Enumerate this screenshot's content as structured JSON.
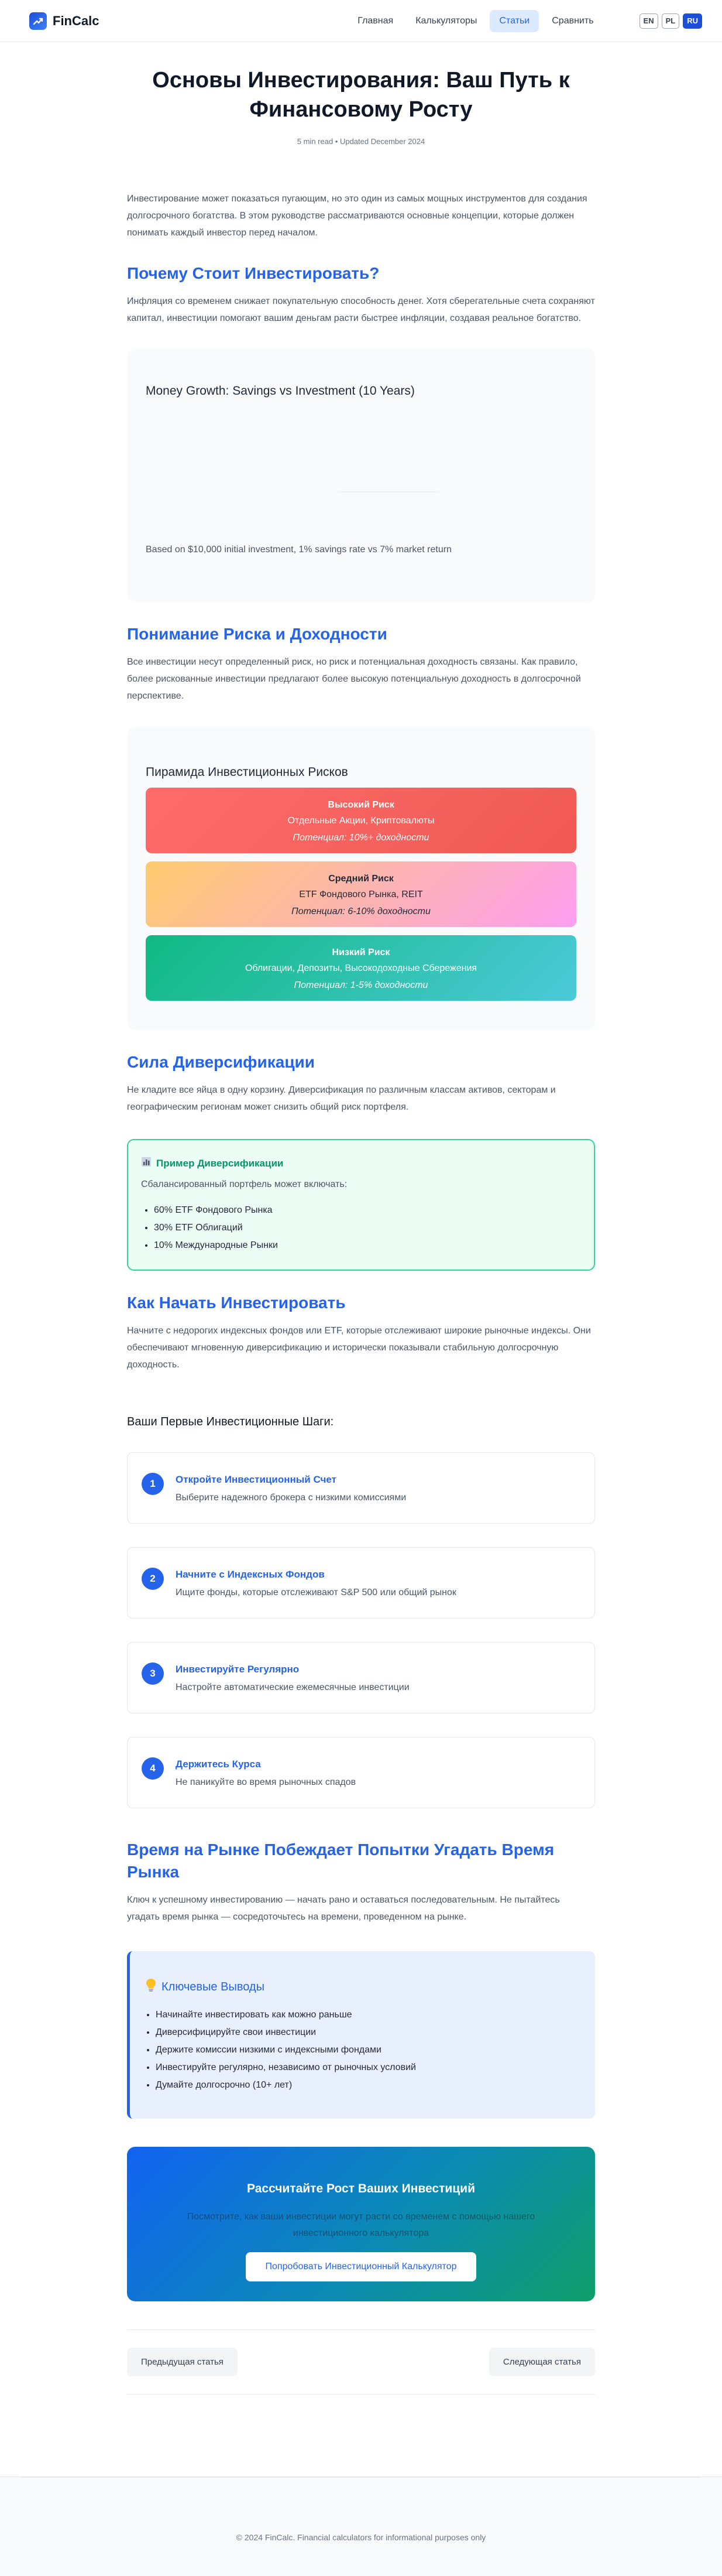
{
  "header": {
    "logo_text": "FinCalc",
    "nav": [
      "Главная",
      "Калькуляторы",
      "Статьи",
      "Сравнить"
    ],
    "active_nav": "Статьи",
    "languages": [
      "EN",
      "PL",
      "RU"
    ],
    "active_language": "RU"
  },
  "article": {
    "title": "Основы Инвестирования: Ваш Путь к Финансовому Росту",
    "meta": "5 min read • Updated December 2024",
    "intro": "Инвестирование может показаться пугающим, но это один из самых мощных инструментов для создания долгосрочного богатства. В этом руководстве рассматриваются основные концепции, которые должен понимать каждый инвестор перед началом.",
    "section1": {
      "heading": "Почему Стоит Инвестировать?",
      "text": "Инфляция со временем снижает покупательную способность денег. Хотя сберегательные счета сохраняют капитал, инвестиции помогают вашим деньгам расти быстрее инфляции, создавая реальное богатство."
    },
    "chart": {
      "title": "Money Growth: Savings vs Investment (10 Years)",
      "note": "Based on $10,000 initial investment, 1% savings rate vs 7% market return"
    },
    "section2": {
      "heading": "Понимание Риска и Доходности",
      "text": "Все инвестиции несут определенный риск, но риск и потенциальная доходность связаны. Как правило, более рискованные инвестиции предлагают более высокую потенциальную доходность в долгосрочной перспективе."
    },
    "pyramid": {
      "title": "Пирамида Инвестиционных Рисков",
      "tiers": [
        {
          "title": "Высокий Риск",
          "desc": "Отдельные Акции, Криптовалюты",
          "potential": "Потенциал: 10%+ доходности"
        },
        {
          "title": "Средний Риск",
          "desc": "ETF Фондового Рынка, REIT",
          "potential": "Потенциал: 6-10% доходности"
        },
        {
          "title": "Низкий Риск",
          "desc": "Облигации, Депозиты, Высокодоходные Сбережения",
          "potential": "Потенциал: 1-5% доходности"
        }
      ]
    },
    "section3": {
      "heading": "Сила Диверсификации",
      "text": "Не кладите все яйца в одну корзину. Диверсификация по различным классам активов, секторам и географическим регионам может снизить общий риск портфеля."
    },
    "example": {
      "icon": "bar-chart-icon",
      "title": "Пример Диверсификации",
      "subtitle": "Сбалансированный портфель может включать:",
      "items": [
        "60% ETF Фондового Рынка",
        "30% ETF Облигаций",
        "10% Международные Рынки"
      ]
    },
    "section4": {
      "heading": "Как Начать Инвестировать",
      "text": "Начните с недорогих индексных фондов или ETF, которые отслеживают широкие рыночные индексы. Они обеспечивают мгновенную диверсификацию и исторически показывали стабильную долгосрочную доходность."
    },
    "steps": {
      "title": "Ваши Первые Инвестиционные Шаги:",
      "items": [
        {
          "num": "1",
          "title": "Откройте Инвестиционный Счет",
          "desc": "Выберите надежного брокера с низкими комиссиями"
        },
        {
          "num": "2",
          "title": "Начните с Индексных Фондов",
          "desc": "Ищите фонды, которые отслеживают S&P 500 или общий рынок"
        },
        {
          "num": "3",
          "title": "Инвестируйте Регулярно",
          "desc": "Настройте автоматические ежемесячные инвестиции"
        },
        {
          "num": "4",
          "title": "Держитесь Курса",
          "desc": "Не паникуйте во время рыночных спадов"
        }
      ]
    },
    "section5": {
      "heading": "Время на Рынке Побеждает Попытки Угадать Время Рынка",
      "text": "Ключ к успешному инвестированию — начать рано и оставаться последовательным. Не пытайтесь угадать время рынка — сосредоточьтесь на времени, проведенном на рынке."
    },
    "takeaways": {
      "icon": "lightbulb-icon",
      "title": "Ключевые Выводы",
      "items": [
        "Начинайте инвестировать как можно раньше",
        "Диверсифицируйте свои инвестиции",
        "Держите комиссии низкими с индексными фондами",
        "Инвестируйте регулярно, независимо от рыночных условий",
        "Думайте долгосрочно (10+ лет)"
      ]
    },
    "cta": {
      "title": "Рассчитайте Рост Ваших Инвестиций",
      "text": "Посмотрите, как ваши инвестиции могут расти со временем с помощью нашего инвестиционного калькулятора",
      "button": "Попробовать Инвестиционный Калькулятор"
    },
    "pager": {
      "prev": "Предыдущая статья",
      "next": "Следующая статья"
    }
  },
  "footer": {
    "text": "© 2024 FinCalc. Financial calculators for informational purposes only"
  }
}
